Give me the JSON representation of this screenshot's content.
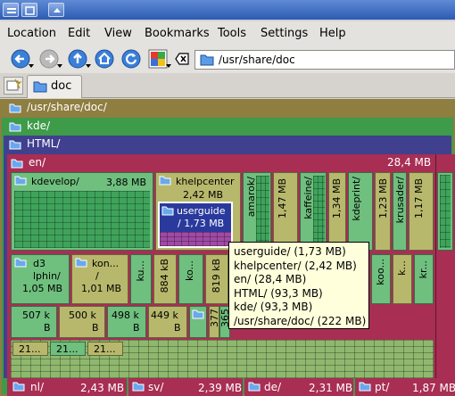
{
  "menu": {
    "items": [
      "Location",
      "Edit",
      "View",
      "Bookmarks",
      "Tools",
      "Settings",
      "Help"
    ]
  },
  "toolbar": {
    "location_value": "/usr/share/doc"
  },
  "tabs": [
    {
      "label": "doc"
    }
  ],
  "treemap": {
    "bands": {
      "root": "/usr/share/doc/",
      "kde": "kde/",
      "html": "HTML/",
      "en": "en/",
      "en_size": "28,4 MB"
    },
    "cells": {
      "kdevelop": {
        "name": "kdevelop/",
        "size": "3,88 MB"
      },
      "khelpcenter": {
        "name": "khelpcenter",
        "size": "2,42 MB"
      },
      "userguide": {
        "name": "userguide",
        "size": "/ 1,73 MB"
      },
      "amarok": "amarok/",
      "kaffeine": "kaffeine/",
      "kdeprint": "kdeprint/",
      "krusader": "krusader/",
      "s_147": "1,47 MB",
      "s_134": "1,34 MB",
      "s_123": "1,23 MB",
      "s_117": "1,17 MB",
      "k3b_a": "d3",
      "k3b_b": "lphin/",
      "k3b_c": "1,05 MB",
      "kon_a": "kon...",
      "kon_b": "/",
      "kon_c": "1,01 MB",
      "v884": "884 kB",
      "v819": "819 kB",
      "v_ku": "ku...",
      "v_ko": "ko...",
      "v_koo": "koo...",
      "v_kc": "k...",
      "v_kr": "kr...",
      "s_507": "507 k",
      "s_507b": "B",
      "s_500": "500 k",
      "s_500b": "B",
      "s_498": "498 k",
      "s_498b": "B",
      "s_449": "449 k",
      "s_449b": "B",
      "v377": "377",
      "v365": "365",
      "s_21a": "21...",
      "s_21b": "21...",
      "s_21c": "21..."
    },
    "bottom": [
      {
        "name": "nl/",
        "size": "2,43 MB"
      },
      {
        "name": "sv/",
        "size": "2,39 MB"
      },
      {
        "name": "de/",
        "size": "2,31 MB"
      },
      {
        "name": "pt/",
        "size": "1,87 MB"
      }
    ]
  },
  "tooltip": {
    "lines": [
      "userguide/ (1,73 MB)",
      "khelpcenter/ (2,42 MB)",
      "en/ (28,4 MB)",
      "HTML/ (93,3 MB)",
      "kde/ (93,3 MB)",
      "/usr/share/doc/ (222 MB)"
    ]
  },
  "colors": {
    "root_band": "#8e7e40",
    "kde_band": "#3d9b49",
    "html_band": "#40408f",
    "en_band": "#a82e54",
    "cells_main": "#6fbf7e",
    "cells_alt": "#b7b86c",
    "tooltip_bg": "#ffffdc"
  }
}
